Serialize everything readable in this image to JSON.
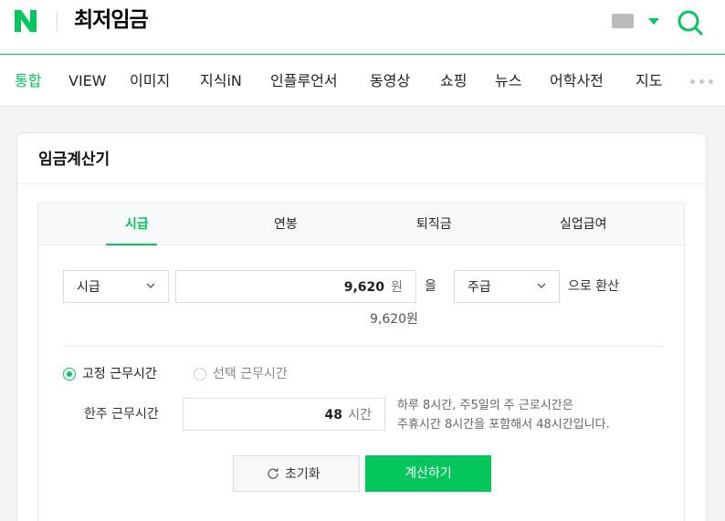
{
  "header": {
    "logo_letter": "N",
    "query": "최저임금",
    "brand_color": "#03c75a"
  },
  "tabs": [
    {
      "label": "통합",
      "active": true
    },
    {
      "label": "VIEW"
    },
    {
      "label": "이미지"
    },
    {
      "label": "지식iN"
    },
    {
      "label": "인플루언서"
    },
    {
      "label": "동영상"
    },
    {
      "label": "쇼핑"
    },
    {
      "label": "뉴스"
    },
    {
      "label": "어학사전"
    },
    {
      "label": "지도"
    }
  ],
  "card": {
    "title": "임금계산기",
    "calc_tabs": [
      "시급",
      "연봉",
      "퇴직금",
      "실업급여"
    ],
    "from_select": "시급",
    "amount_value": "9,620",
    "amount_unit": "원",
    "particle": "을",
    "to_select": "주급",
    "convert_text": "으로 환산",
    "sub_amount": "9,620원",
    "radio_fixed": "고정 근무시간",
    "radio_select": "선택 근무시간",
    "hours_label": "한주 근무시간",
    "hours_value": "48",
    "hours_unit": "시간",
    "note_line1": "하루 8시간, 주5일의 주 근로시간은",
    "note_line2": "주휴시간 8시간을 포함해서 48시간입니다.",
    "reset_label": "초기화",
    "calc_label": "계산하기"
  }
}
